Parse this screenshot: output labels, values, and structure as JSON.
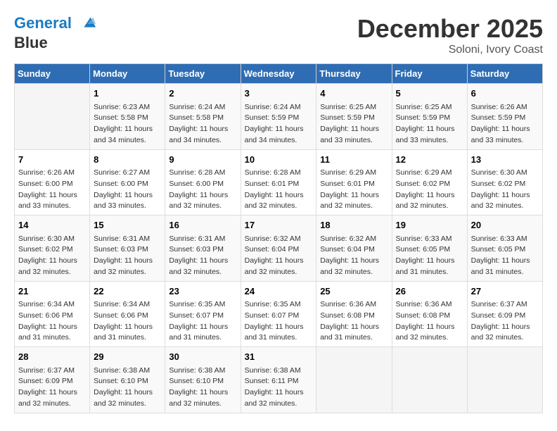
{
  "logo": {
    "line1": "General",
    "line2": "Blue"
  },
  "title": "December 2025",
  "location": "Soloni, Ivory Coast",
  "days_of_week": [
    "Sunday",
    "Monday",
    "Tuesday",
    "Wednesday",
    "Thursday",
    "Friday",
    "Saturday"
  ],
  "weeks": [
    [
      {
        "num": "",
        "detail": ""
      },
      {
        "num": "1",
        "detail": "Sunrise: 6:23 AM\nSunset: 5:58 PM\nDaylight: 11 hours\nand 34 minutes."
      },
      {
        "num": "2",
        "detail": "Sunrise: 6:24 AM\nSunset: 5:58 PM\nDaylight: 11 hours\nand 34 minutes."
      },
      {
        "num": "3",
        "detail": "Sunrise: 6:24 AM\nSunset: 5:59 PM\nDaylight: 11 hours\nand 34 minutes."
      },
      {
        "num": "4",
        "detail": "Sunrise: 6:25 AM\nSunset: 5:59 PM\nDaylight: 11 hours\nand 33 minutes."
      },
      {
        "num": "5",
        "detail": "Sunrise: 6:25 AM\nSunset: 5:59 PM\nDaylight: 11 hours\nand 33 minutes."
      },
      {
        "num": "6",
        "detail": "Sunrise: 6:26 AM\nSunset: 5:59 PM\nDaylight: 11 hours\nand 33 minutes."
      }
    ],
    [
      {
        "num": "7",
        "detail": "Sunrise: 6:26 AM\nSunset: 6:00 PM\nDaylight: 11 hours\nand 33 minutes."
      },
      {
        "num": "8",
        "detail": "Sunrise: 6:27 AM\nSunset: 6:00 PM\nDaylight: 11 hours\nand 33 minutes."
      },
      {
        "num": "9",
        "detail": "Sunrise: 6:28 AM\nSunset: 6:00 PM\nDaylight: 11 hours\nand 32 minutes."
      },
      {
        "num": "10",
        "detail": "Sunrise: 6:28 AM\nSunset: 6:01 PM\nDaylight: 11 hours\nand 32 minutes."
      },
      {
        "num": "11",
        "detail": "Sunrise: 6:29 AM\nSunset: 6:01 PM\nDaylight: 11 hours\nand 32 minutes."
      },
      {
        "num": "12",
        "detail": "Sunrise: 6:29 AM\nSunset: 6:02 PM\nDaylight: 11 hours\nand 32 minutes."
      },
      {
        "num": "13",
        "detail": "Sunrise: 6:30 AM\nSunset: 6:02 PM\nDaylight: 11 hours\nand 32 minutes."
      }
    ],
    [
      {
        "num": "14",
        "detail": "Sunrise: 6:30 AM\nSunset: 6:02 PM\nDaylight: 11 hours\nand 32 minutes."
      },
      {
        "num": "15",
        "detail": "Sunrise: 6:31 AM\nSunset: 6:03 PM\nDaylight: 11 hours\nand 32 minutes."
      },
      {
        "num": "16",
        "detail": "Sunrise: 6:31 AM\nSunset: 6:03 PM\nDaylight: 11 hours\nand 32 minutes."
      },
      {
        "num": "17",
        "detail": "Sunrise: 6:32 AM\nSunset: 6:04 PM\nDaylight: 11 hours\nand 32 minutes."
      },
      {
        "num": "18",
        "detail": "Sunrise: 6:32 AM\nSunset: 6:04 PM\nDaylight: 11 hours\nand 32 minutes."
      },
      {
        "num": "19",
        "detail": "Sunrise: 6:33 AM\nSunset: 6:05 PM\nDaylight: 11 hours\nand 31 minutes."
      },
      {
        "num": "20",
        "detail": "Sunrise: 6:33 AM\nSunset: 6:05 PM\nDaylight: 11 hours\nand 31 minutes."
      }
    ],
    [
      {
        "num": "21",
        "detail": "Sunrise: 6:34 AM\nSunset: 6:06 PM\nDaylight: 11 hours\nand 31 minutes."
      },
      {
        "num": "22",
        "detail": "Sunrise: 6:34 AM\nSunset: 6:06 PM\nDaylight: 11 hours\nand 31 minutes."
      },
      {
        "num": "23",
        "detail": "Sunrise: 6:35 AM\nSunset: 6:07 PM\nDaylight: 11 hours\nand 31 minutes."
      },
      {
        "num": "24",
        "detail": "Sunrise: 6:35 AM\nSunset: 6:07 PM\nDaylight: 11 hours\nand 31 minutes."
      },
      {
        "num": "25",
        "detail": "Sunrise: 6:36 AM\nSunset: 6:08 PM\nDaylight: 11 hours\nand 31 minutes."
      },
      {
        "num": "26",
        "detail": "Sunrise: 6:36 AM\nSunset: 6:08 PM\nDaylight: 11 hours\nand 32 minutes."
      },
      {
        "num": "27",
        "detail": "Sunrise: 6:37 AM\nSunset: 6:09 PM\nDaylight: 11 hours\nand 32 minutes."
      }
    ],
    [
      {
        "num": "28",
        "detail": "Sunrise: 6:37 AM\nSunset: 6:09 PM\nDaylight: 11 hours\nand 32 minutes."
      },
      {
        "num": "29",
        "detail": "Sunrise: 6:38 AM\nSunset: 6:10 PM\nDaylight: 11 hours\nand 32 minutes."
      },
      {
        "num": "30",
        "detail": "Sunrise: 6:38 AM\nSunset: 6:10 PM\nDaylight: 11 hours\nand 32 minutes."
      },
      {
        "num": "31",
        "detail": "Sunrise: 6:38 AM\nSunset: 6:11 PM\nDaylight: 11 hours\nand 32 minutes."
      },
      {
        "num": "",
        "detail": ""
      },
      {
        "num": "",
        "detail": ""
      },
      {
        "num": "",
        "detail": ""
      }
    ]
  ]
}
